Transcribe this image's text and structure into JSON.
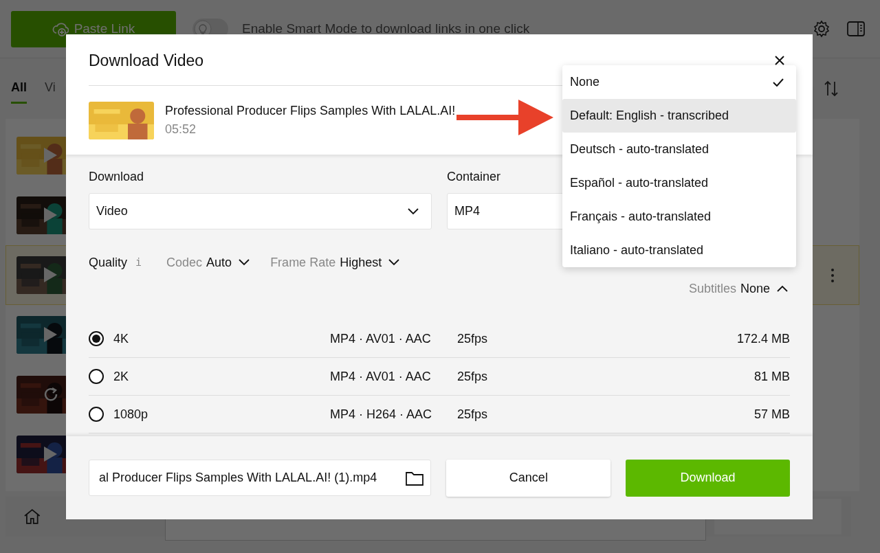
{
  "app": {
    "paste_button": "Paste Link",
    "smart_mode": {
      "on": false,
      "label": "Enable Smart Mode to download links in one click"
    },
    "tabs": [
      {
        "label": "All",
        "selected": true
      },
      {
        "label": "Vi",
        "selected": false
      }
    ],
    "library": [
      {
        "kind": "play",
        "selected": false
      },
      {
        "kind": "play",
        "selected": false
      },
      {
        "kind": "play",
        "selected": true
      },
      {
        "kind": "play",
        "selected": false
      },
      {
        "kind": "retry",
        "selected": false
      },
      {
        "kind": "play",
        "selected": false
      }
    ]
  },
  "dialog": {
    "title": "Download Video",
    "video": {
      "title": "Professional Producer Flips Samples With LALAL.AI!",
      "duration": "05:52"
    },
    "download": {
      "label": "Download",
      "value": "Video"
    },
    "container": {
      "label": "Container",
      "value": "MP4"
    },
    "quality_label": "Quality",
    "info": "i",
    "options": [
      {
        "label": "Codec",
        "value": "Auto",
        "expanded": false
      },
      {
        "label": "Frame Rate",
        "value": "Highest",
        "expanded": false
      }
    ],
    "right_options": [
      {
        "label": "Subtitles",
        "value": "None",
        "expanded": true
      }
    ],
    "qualities": [
      {
        "name": "4K",
        "format": "MP4 · AV01 · AAC",
        "fps": "25fps",
        "size": "172.4 MB",
        "selected": true
      },
      {
        "name": "2K",
        "format": "MP4 · AV01 · AAC",
        "fps": "25fps",
        "size": "81 MB",
        "selected": false
      },
      {
        "name": "1080p",
        "format": "MP4 · H264 · AAC",
        "fps": "25fps",
        "size": "57 MB",
        "selected": false
      }
    ],
    "filename": "al Producer Flips Samples With LALAL.AI! (1).mp4",
    "buttons": [
      {
        "label": "Cancel",
        "kind": "secondary"
      },
      {
        "label": "Download",
        "kind": "primary"
      }
    ],
    "subtitle_menu": [
      {
        "label": "None",
        "selected": true,
        "highlighted": false
      },
      {
        "label": "Default: English - transcribed",
        "selected": false,
        "highlighted": true
      },
      {
        "label": "Deutsch - auto-translated",
        "selected": false,
        "highlighted": false
      },
      {
        "label": "Español - auto-translated",
        "selected": false,
        "highlighted": false
      },
      {
        "label": "Français - auto-translated",
        "selected": false,
        "highlighted": false
      },
      {
        "label": "Italiano - auto-translated",
        "selected": false,
        "highlighted": false
      }
    ]
  }
}
